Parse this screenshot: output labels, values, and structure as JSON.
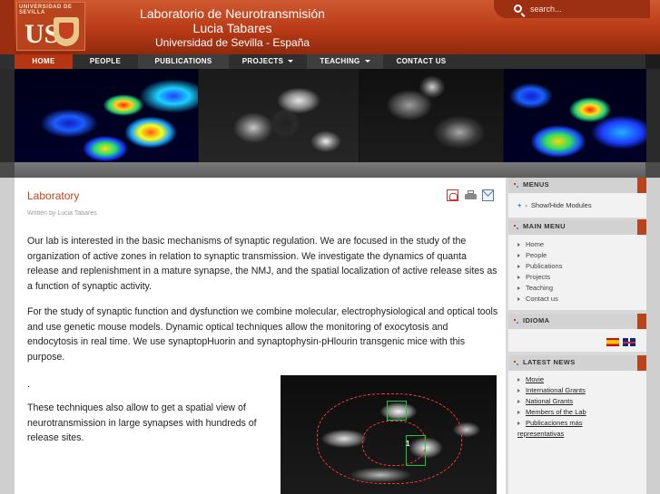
{
  "header": {
    "logo_text": "UNIVERSIDAD DE SEVILLA",
    "logo_letters": "US",
    "title_line1": "Laboratorio de Neurotransmisión",
    "title_line2": "Lucia Tabares",
    "title_line3": "Universidad de Sevilla - España",
    "search_placeholder": "search..."
  },
  "nav": {
    "items": [
      {
        "label": "HOME",
        "active": true
      },
      {
        "label": "PEOPLE"
      },
      {
        "label": "PUBLICATIONS"
      },
      {
        "label": "PROJECTS",
        "dropdown": true
      },
      {
        "label": "TEACHING",
        "dropdown": true
      },
      {
        "label": "CONTACT US"
      }
    ]
  },
  "article": {
    "title": "Laboratory",
    "byline": "Written by Lucia Tabares",
    "paragraphs": [
      "Our lab is interested in the basic mechanisms of synaptic regulation. We are focused in the study of the organization of active zones in relation to synaptic transmission. We investigate the dynamics of quanta release and replenishment in a mature synapse, the NMJ, and the spatial localization of active release sites as a function of synaptic activity.",
      "For the study of synaptic function and dysfunction we combine molecular, electrophysiological and optical tools and use genetic mouse models. Dynamic optical techniques allow the monitoring of exocytosis and endocytosis in real time. We use synaptopHuorin and synaptophysin-pHlourin transgenic mice with this purpose.",
      ".",
      "These techniques also allow to get a spatial view of neurotransmission in large synapses with hundreds of release sites."
    ],
    "image_label": "1"
  },
  "sidebar": {
    "menus": {
      "title": "MENUS",
      "show_hide": "Show/Hide Modules"
    },
    "main_menu": {
      "title": "MAIN MENU",
      "items": [
        "Home",
        "People",
        "Publications",
        "Projects",
        "Teaching",
        "Contact us"
      ]
    },
    "idioma": {
      "title": "IDIOMA"
    },
    "latest_news": {
      "title": "LATEST NEWS",
      "items": [
        "Movie",
        "International Grants",
        "National Grants",
        "Members of the Lab",
        "Publicaciones más representativas"
      ]
    }
  },
  "colors": {
    "brand": "#b83a17",
    "accent_text": "#c0441a",
    "nav_bg": "#2f2f2f"
  }
}
